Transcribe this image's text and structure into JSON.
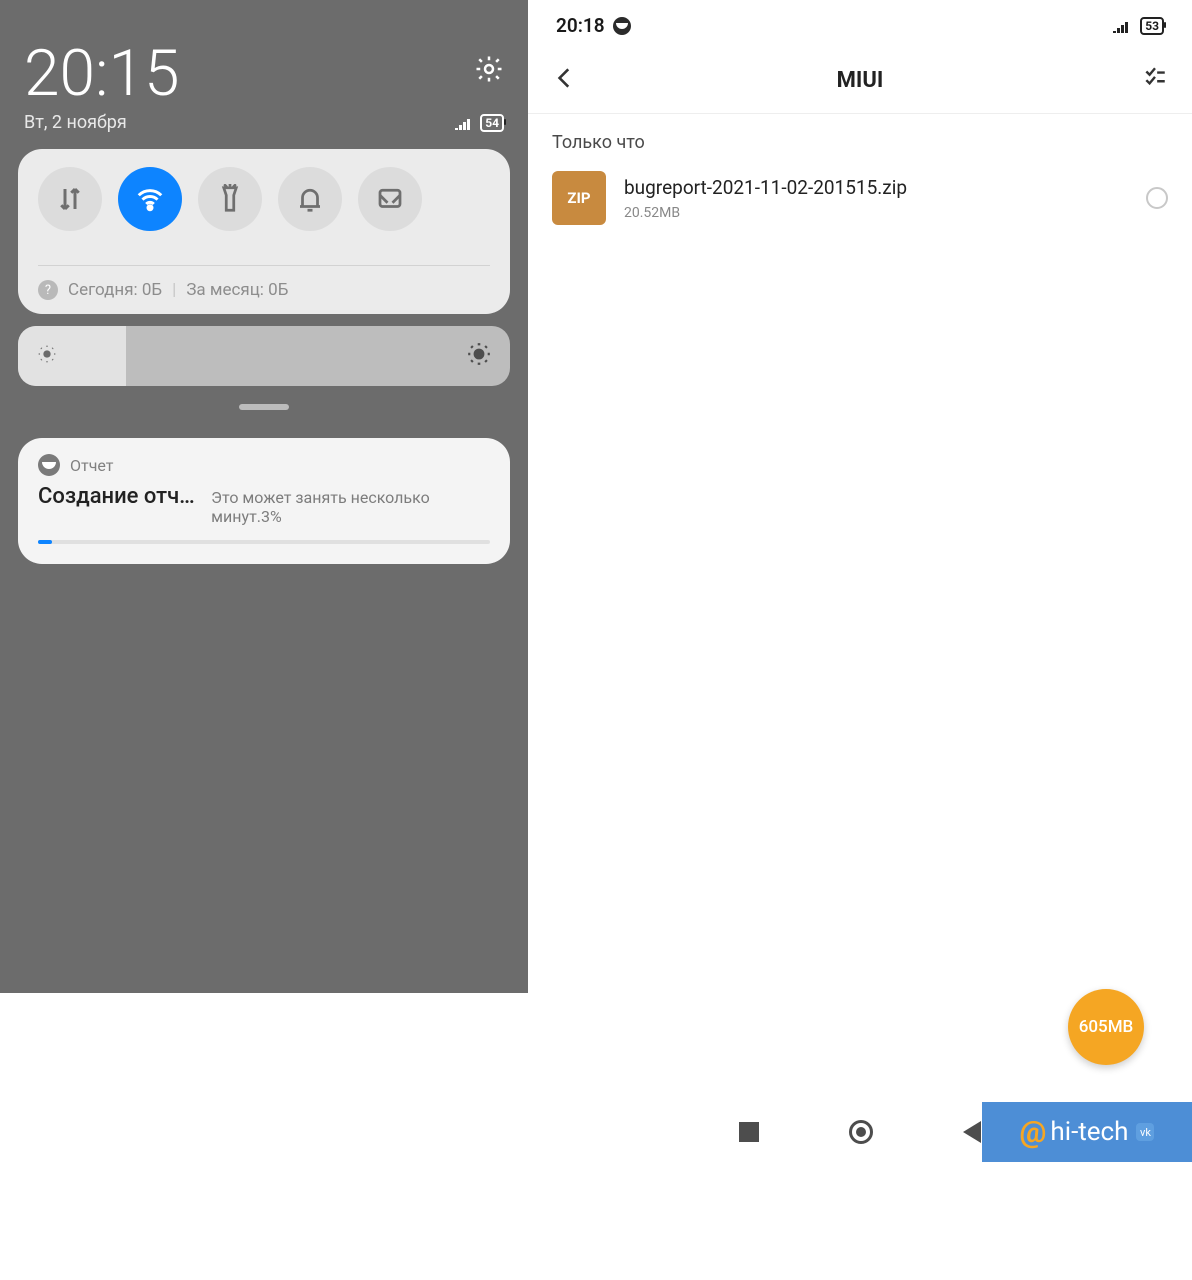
{
  "left": {
    "clock": "20:15",
    "date": "Вт, 2 ноября",
    "battery": "54",
    "usage": {
      "today_label": "Сегодня: 0Б",
      "month_label": "За месяц: 0Б"
    },
    "notification": {
      "app": "Отчет",
      "title": "Создание отче..",
      "subtitle": "Это может занять несколько минут.3%",
      "progress_pct": 3
    }
  },
  "right": {
    "status_time": "20:18",
    "battery": "53",
    "title": "MIUI",
    "section": "Только что",
    "file": {
      "badge": "ZIP",
      "name": "bugreport-2021-11-02-201515.zip",
      "size": "20.52MB"
    },
    "fab": "605MB",
    "watermark": "hi-tech"
  }
}
